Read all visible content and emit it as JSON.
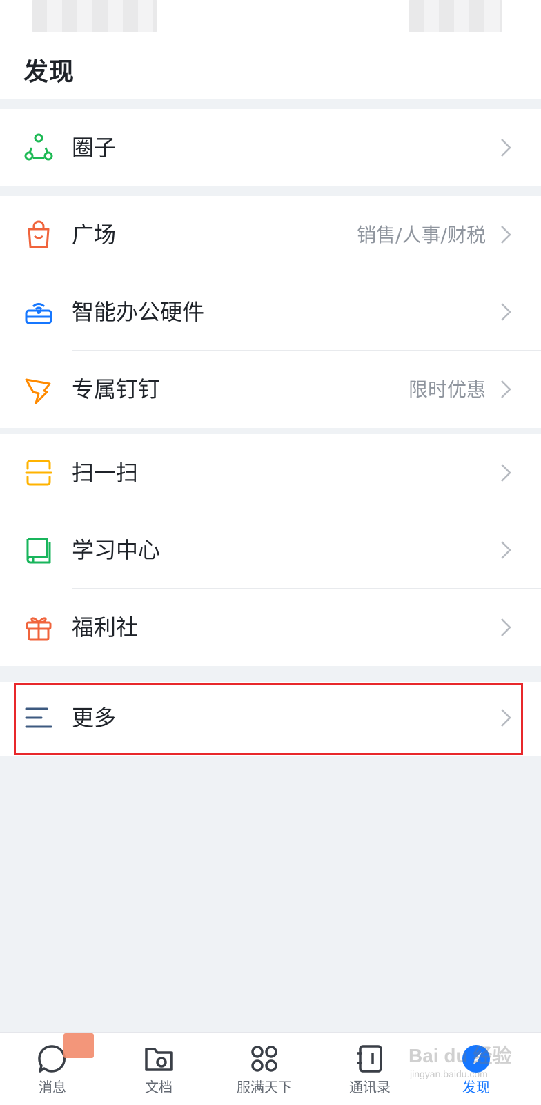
{
  "header": {
    "title": "发现"
  },
  "groups": [
    {
      "items": [
        {
          "label": "圈子",
          "sub": "",
          "icon": "circle-network-icon",
          "color": "#1db954"
        }
      ]
    },
    {
      "items": [
        {
          "label": "广场",
          "sub": "销售/人事/财税",
          "icon": "shopping-bag-icon",
          "color": "#f0643c"
        },
        {
          "label": "智能办公硬件",
          "sub": "",
          "icon": "smart-device-icon",
          "color": "#1677ff"
        },
        {
          "label": "专属钉钉",
          "sub": "限时优惠",
          "icon": "dingtalk-wing-icon",
          "color": "#ff8a00"
        }
      ]
    },
    {
      "items": [
        {
          "label": "扫一扫",
          "sub": "",
          "icon": "scan-icon",
          "color": "#ffb300"
        },
        {
          "label": "学习中心",
          "sub": "",
          "icon": "book-icon",
          "color": "#19b55c"
        },
        {
          "label": "福利社",
          "sub": "",
          "icon": "gift-icon",
          "color": "#f0643c"
        }
      ]
    },
    {
      "items": [
        {
          "label": "更多",
          "sub": "",
          "icon": "menu-lines-icon",
          "color": "#3d5a80"
        }
      ]
    }
  ],
  "tabbar": {
    "items": [
      {
        "label": "消息",
        "icon": "chat-bubble-icon",
        "active": false
      },
      {
        "label": "文档",
        "icon": "folder-icon",
        "active": false
      },
      {
        "label": "服满天下",
        "icon": "grid-apps-icon",
        "active": false
      },
      {
        "label": "通讯录",
        "icon": "contacts-book-icon",
        "active": false
      },
      {
        "label": "发现",
        "icon": "compass-icon",
        "active": true
      }
    ]
  },
  "watermark": {
    "text": "Bai du 经验",
    "sub": "jingyan.baidu.com"
  },
  "colors": {
    "accent": "#1677ff",
    "highlight_box": "#e8282b",
    "background": "#eff2f5"
  }
}
